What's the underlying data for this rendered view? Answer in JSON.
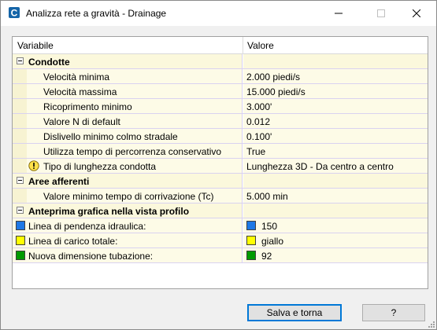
{
  "window": {
    "title": "Analizza rete a gravità - Drainage"
  },
  "colors": {
    "accent": "#0078d7",
    "cell_bg": "#fdfbe7",
    "blue_swatch": "#1e78e6",
    "yellow_swatch": "#ffff00",
    "green_swatch": "#009a00"
  },
  "grid": {
    "header": {
      "col_variable": "Variabile",
      "col_value": "Valore"
    },
    "categories": [
      {
        "label": "Condotte",
        "props": [
          {
            "label": "Velocità minima",
            "value": "2.000 piedi/s"
          },
          {
            "label": "Velocità massima",
            "value": "15.000 piedi/s"
          },
          {
            "label": "Ricoprimento minimo",
            "value": "3.000'"
          },
          {
            "label": "Valore N di default",
            "value": "0.012"
          },
          {
            "label": "Dislivello minimo colmo stradale",
            "value": "0.100'"
          },
          {
            "label": "Utilizza tempo di percorrenza conservativo",
            "value": "True"
          },
          {
            "label": "Tipo di lunghezza condotta",
            "value": "Lunghezza 3D - Da centro a centro",
            "icon": "warning-icon"
          }
        ]
      },
      {
        "label": "Aree afferenti",
        "props": [
          {
            "label": "Valore minimo tempo di corrivazione (Tc)",
            "value": "5.000 min"
          }
        ]
      },
      {
        "label": "Anteprima grafica nella vista profilo",
        "props": [
          {
            "label": "Linea di pendenza idraulica:",
            "value": "150",
            "swatch": "blue"
          },
          {
            "label": "Linea di carico totale:",
            "value": "giallo",
            "swatch": "yellow"
          },
          {
            "label": "Nuova dimensione tubazione:",
            "value": "92",
            "swatch": "green"
          }
        ]
      }
    ]
  },
  "buttons": {
    "save": "Salva e torna",
    "help": "?"
  }
}
